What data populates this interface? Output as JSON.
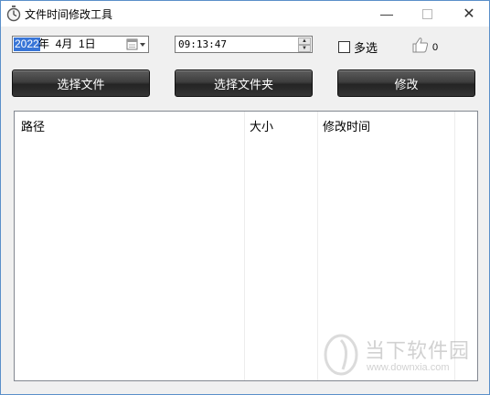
{
  "window": {
    "title": "文件时间修改工具"
  },
  "titlebar_buttons": {
    "minimize": "—",
    "close": "✕"
  },
  "date_picker": {
    "year": "2022",
    "rest": "年  4月  1日"
  },
  "time_picker": {
    "value": "09:13:47"
  },
  "options": {
    "multi_select_label": "多选",
    "multi_select_checked": false
  },
  "like": {
    "count": "0"
  },
  "buttons": {
    "select_file": "选择文件",
    "select_folder": "选择文件夹",
    "modify": "修改"
  },
  "list": {
    "columns": [
      "路径",
      "大小",
      "修改时间"
    ],
    "rows": []
  },
  "watermark": {
    "text": "当下软件园",
    "url": "www.downxia.com"
  },
  "colors": {
    "title_border": "#5a8fc9",
    "selection": "#3875d7",
    "button_dark": "#2e2e2e"
  }
}
